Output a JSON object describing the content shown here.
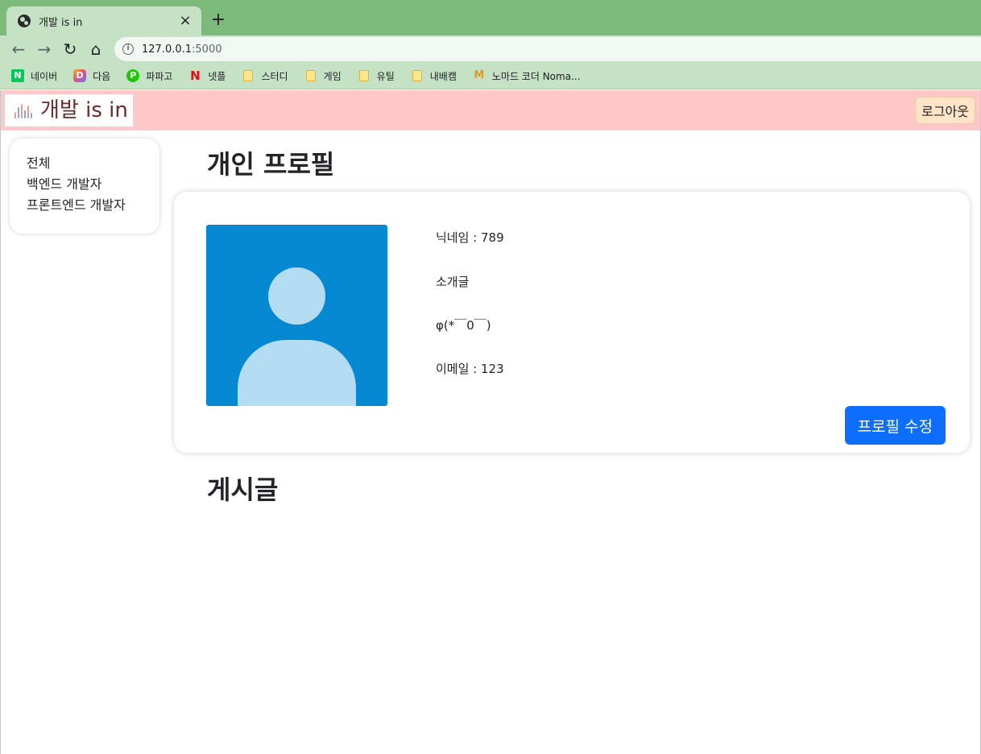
{
  "browser": {
    "tab_title": "개발 is in",
    "tab_close": "×",
    "new_tab": "+",
    "back": "←",
    "forward": "→",
    "reload": "↻",
    "home": "⌂",
    "url_host": "127.0.0.1",
    "url_port": ":5000",
    "info": "i",
    "bookmarks": [
      {
        "label": "네이버",
        "icon": "naver-icon",
        "glyph": "N"
      },
      {
        "label": "다음",
        "icon": "daum-icon",
        "glyph": "D"
      },
      {
        "label": "파파고",
        "icon": "papago-icon",
        "glyph": "P"
      },
      {
        "label": "넷플",
        "icon": "netflix-icon",
        "glyph": "N"
      },
      {
        "label": "스터디",
        "icon": "folder-icon",
        "glyph": ""
      },
      {
        "label": "게임",
        "icon": "folder-icon",
        "glyph": ""
      },
      {
        "label": "유틸",
        "icon": "folder-icon",
        "glyph": ""
      },
      {
        "label": "내배캠",
        "icon": "folder-icon",
        "glyph": ""
      },
      {
        "label": "노마드 코더 Noma...",
        "icon": "nomad-icon",
        "glyph": "M"
      }
    ]
  },
  "navbar": {
    "brand": "개발 is in",
    "logout": "로그아웃"
  },
  "sidebar": {
    "items": [
      "전체",
      "백엔드 개발자",
      "프론트엔드 개발자"
    ]
  },
  "profile": {
    "heading": "개인 프로필",
    "nickname": "닉네임 : 789",
    "intro_label": "소개글",
    "intro_text": "φ(*￣0￣)",
    "email": "이메일 : 123",
    "edit_button": "프로필 수정"
  },
  "posts": {
    "heading": "게시글"
  },
  "colors": {
    "navbar_bg": "#ffc8c8",
    "brand_text": "#6e2b2b",
    "primary_button": "#0d6efd",
    "avatar_bg": "#0488d1"
  }
}
